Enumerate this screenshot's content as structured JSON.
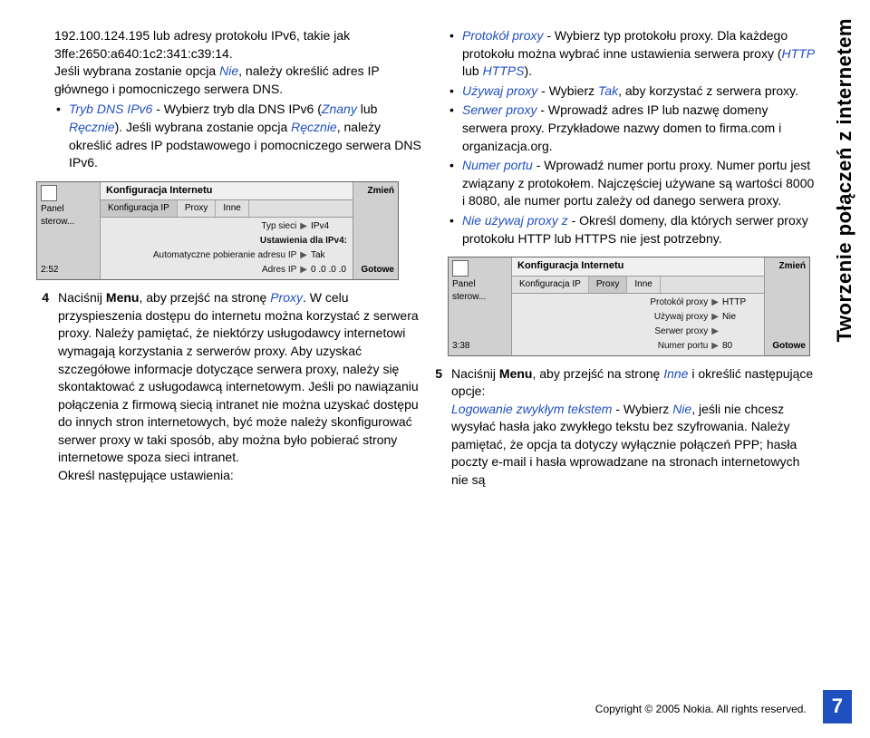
{
  "sidebar_title": "Tworzenie połączeń z internetem",
  "left": {
    "para1_a": "192.100.124.195 lub adresy protokołu IPv6, takie jak 3ffe:2650:a640:1c2:341:c39:14.",
    "para1_b": "Jeśli wybrana zostanie opcja ",
    "para1_nie": "Nie",
    "para1_c": ", należy określić adres IP głównego i pomocniczego serwera DNS.",
    "bullet1_a": "Tryb DNS IPv6",
    "bullet1_b": " - Wybierz tryb dla DNS IPv6 (",
    "bullet1_znany": "Znany",
    "bullet1_lub": " lub ",
    "bullet1_recznie": "Ręcznie",
    "bullet1_c": "). Jeśli wybrana zostanie opcja ",
    "bullet1_recznie2": "Ręcznie",
    "bullet1_d": ", należy określić adres IP podstawowego i pomocniczego serwera DNS IPv6.",
    "phone1": {
      "title": "Konfiguracja Internetu",
      "tabs": [
        "Konfiguracja IP",
        "Proxy",
        "Inne"
      ],
      "left_label": "Panel sterow...",
      "left_time": "2:52",
      "right_top": "Zmień",
      "right_bottom": "Gotowe",
      "fields": [
        {
          "label": "Typ sieci",
          "value": "IPv4"
        },
        {
          "label": "Ustawienia dla IPv4:",
          "value": ""
        },
        {
          "label": "Automatyczne pobieranie adresu IP",
          "value": "Tak"
        },
        {
          "label": "Adres IP",
          "value": "0   .0   .0   .0"
        }
      ]
    },
    "step4_num": "4",
    "step4_a": "Naciśnij ",
    "step4_menu": "Menu",
    "step4_b": ", aby przejść na stronę ",
    "step4_proxy": "Proxy",
    "step4_c": ". W celu przyspieszenia dostępu do internetu można korzystać z serwera proxy. Należy pamiętać, że niektórzy usługodawcy internetowi wymagają korzystania z serwerów proxy. Aby uzyskać szczegółowe informacje dotyczące serwera proxy, należy się skontaktować z usługodawcą internetowym. Jeśli po nawiązaniu połączenia z firmową siecią intranet nie można uzyskać dostępu do innych stron internetowych, być może należy skonfigurować serwer proxy w taki sposób, aby można było pobierać strony internetowe spoza sieci intranet.",
    "step4_d": "Określ następujące ustawienia:"
  },
  "right": {
    "b1_a": "Protokół proxy",
    "b1_b": " - Wybierz typ protokołu proxy. Dla każdego protokołu można wybrać inne ustawienia serwera proxy (",
    "b1_http": "HTTP",
    "b1_lub": " lub ",
    "b1_https": "HTTPS",
    "b1_c": ").",
    "b2_a": "Używaj proxy",
    "b2_b": " - Wybierz ",
    "b2_tak": "Tak",
    "b2_c": ", aby korzystać z serwera proxy.",
    "b3_a": "Serwer proxy",
    "b3_b": " - Wprowadź adres IP lub nazwę domeny serwera proxy. Przykładowe nazwy domen to firma.com i organizacja.org.",
    "b4_a": "Numer portu",
    "b4_b": " - Wprowadź numer portu proxy. Numer portu jest związany z protokołem. Najczęściej używane są wartości 8000 i 8080, ale numer portu zależy od danego serwera proxy.",
    "b5_a": "Nie używaj proxy z",
    "b5_b": " - Określ domeny, dla których serwer proxy protokołu HTTP lub HTTPS nie jest potrzebny.",
    "phone2": {
      "title": "Konfiguracja Internetu",
      "tabs": [
        "Konfiguracja IP",
        "Proxy",
        "Inne"
      ],
      "left_label": "Panel sterow...",
      "left_time": "3:38",
      "right_top": "Zmień",
      "right_bottom": "Gotowe",
      "fields": [
        {
          "label": "Protokół proxy",
          "value": "HTTP"
        },
        {
          "label": "Używaj proxy",
          "value": "Nie"
        },
        {
          "label": "Serwer proxy",
          "value": ""
        },
        {
          "label": "Numer portu",
          "value": "80"
        }
      ]
    },
    "step5_num": "5",
    "step5_a": "Naciśnij ",
    "step5_menu": "Menu",
    "step5_b": ", aby przejść na stronę ",
    "step5_inne": "Inne",
    "step5_c": " i określić następujące opcje:",
    "step5_log": "Logowanie zwykłym tekstem",
    "step5_d": " - Wybierz ",
    "step5_nie": "Nie",
    "step5_e": ", jeśli nie chcesz wysyłać hasła jako zwykłego tekstu bez szyfrowania. Należy pamiętać, że opcja ta dotyczy wyłącznie połączeń PPP; hasła poczty e-mail i hasła wprowadzane na stronach internetowych nie są"
  },
  "footer": {
    "copyright_a": "Copyright ",
    "copyright_sym": "©",
    "copyright_b": " 2005 Nokia. All rights reserved.",
    "page": "7"
  }
}
